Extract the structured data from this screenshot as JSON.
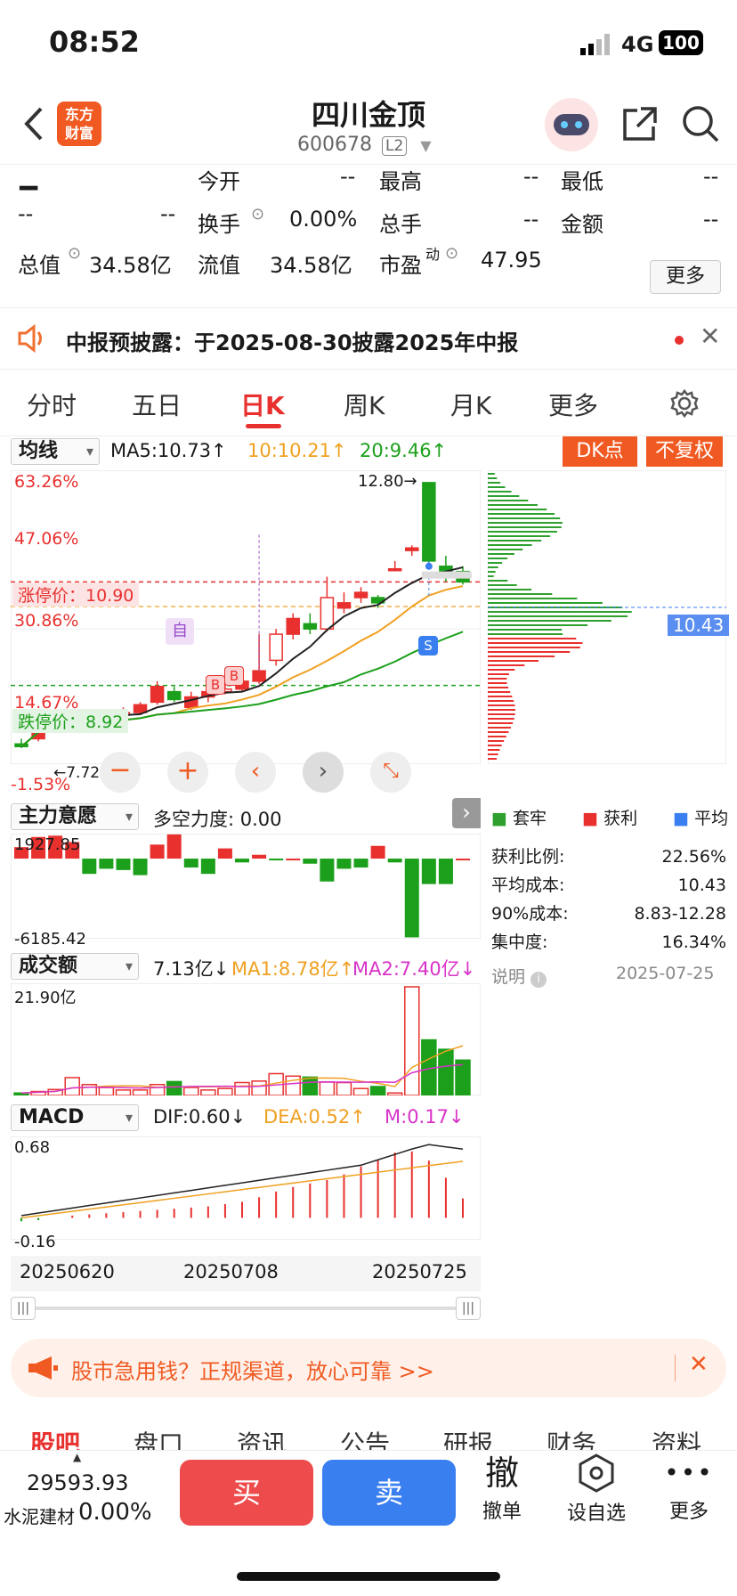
{
  "status": {
    "time": "08:52",
    "network": "4G",
    "battery": "100"
  },
  "header": {
    "title": "四川金顶",
    "code": "600678",
    "level": "L2",
    "logo_line1": "东方",
    "logo_line2": "财富"
  },
  "quote": {
    "price": "--",
    "change": "--",
    "change_pct": "--",
    "open_label": "今开",
    "open": "--",
    "high_label": "最高",
    "high": "--",
    "low_label": "最低",
    "low": "--",
    "turnover_label": "换手",
    "turnover": "0.00%",
    "volume_label": "总手",
    "volume": "--",
    "amount_label": "金额",
    "amount": "--",
    "mktcap_label": "总值",
    "mktcap": "34.58亿",
    "float_label": "流值",
    "float": "34.58亿",
    "pe_label": "市盈",
    "pe_sup": "动",
    "pe": "47.95",
    "more": "更多"
  },
  "notice": {
    "text": "中报预披露：于2025-08-30披露2025年中报"
  },
  "tabs": [
    "分时",
    "五日",
    "日K",
    "周K",
    "月K",
    "更多"
  ],
  "active_tab": "日K",
  "kline": {
    "indicator": "均线",
    "ma5": "MA5:10.73↑",
    "ma10": "10:10.21↑",
    "ma20": "20:9.46↑",
    "dk": "DK点",
    "adjust": "不复权",
    "pct_labels": [
      "63.26%",
      "47.06%",
      "30.86%",
      "14.67%",
      "-1.53%"
    ],
    "limit_up_label": "涨停价：10.90",
    "limit_down_label": "跌停价：8.92",
    "max_label": "12.80→",
    "min_label": "←7.72",
    "marker_self": "自",
    "marker_b1": "B",
    "marker_b2": "B",
    "marker_s": "S",
    "avg_cost_tag": "10.43"
  },
  "mainforce": {
    "label": "主力意愿",
    "force": "多空力度: 0.00",
    "max": "1927.85",
    "min": "-6185.42"
  },
  "chip": {
    "legend": [
      {
        "name": "套牢",
        "color": "#2ea02e"
      },
      {
        "name": "获利",
        "color": "#e8312f"
      },
      {
        "name": "平均",
        "color": "#3a7ff0"
      }
    ],
    "rows": [
      {
        "k": "获利比例:",
        "v": "22.56%"
      },
      {
        "k": "平均成本:",
        "v": "10.43"
      },
      {
        "k": "90%成本:",
        "v": "8.83-12.28"
      },
      {
        "k": "集中度:",
        "v": "16.34%"
      }
    ],
    "note": "说明",
    "date": "2025-07-25"
  },
  "volume": {
    "label": "成交额",
    "cur": "7.13亿↓",
    "ma1": "MA1:8.78亿↑",
    "ma2": "MA2:7.40亿↓",
    "max": "21.90亿"
  },
  "macd": {
    "label": "MACD",
    "dif": "DIF:0.60↓",
    "dea": "DEA:0.52↑",
    "m": "M:0.17↓",
    "max": "0.68",
    "min": "-0.16"
  },
  "dates": [
    "20250620",
    "20250708",
    "20250725"
  ],
  "ad": {
    "text": "股市急用钱？正规渠道，放心可靠 >>"
  },
  "subtabs": [
    "股吧",
    "盘口",
    "资讯",
    "公告",
    "研报",
    "财务",
    "资料"
  ],
  "bottom": {
    "index": "29593.93",
    "sector": "水泥建材",
    "sector_pct": "0.00%",
    "buy": "买",
    "sell": "卖",
    "cancel_icon": "撤",
    "cancel": "撤单",
    "watch": "设自选",
    "more": "更多"
  },
  "chart_data": {
    "type": "candlestick",
    "dates_shown": [
      "20250620",
      "20250708",
      "20250725"
    ],
    "candles": [
      {
        "o": 7.8,
        "c": 7.75,
        "h": 7.9,
        "l": 7.72
      },
      {
        "o": 7.9,
        "c": 8.3,
        "h": 8.35,
        "l": 7.85
      },
      {
        "o": 8.4,
        "c": 8.45,
        "h": 8.5,
        "l": 8.3
      },
      {
        "o": 8.2,
        "c": 8.25,
        "h": 8.3,
        "l": 8.15
      },
      {
        "o": 8.3,
        "c": 8.3,
        "h": 8.35,
        "l": 8.2
      },
      {
        "o": 8.3,
        "c": 8.35,
        "h": 8.4,
        "l": 8.25
      },
      {
        "o": 8.35,
        "c": 8.4,
        "h": 8.5,
        "l": 8.3
      },
      {
        "o": 8.4,
        "c": 8.55,
        "h": 8.6,
        "l": 8.35
      },
      {
        "o": 8.6,
        "c": 8.9,
        "h": 9.0,
        "l": 8.55
      },
      {
        "o": 8.8,
        "c": 8.65,
        "h": 8.9,
        "l": 8.6
      },
      {
        "o": 8.5,
        "c": 8.7,
        "h": 8.8,
        "l": 8.45
      },
      {
        "o": 8.7,
        "c": 8.8,
        "h": 8.9,
        "l": 8.6
      },
      {
        "o": 8.8,
        "c": 8.85,
        "h": 8.95,
        "l": 8.75
      },
      {
        "o": 8.85,
        "c": 9.0,
        "h": 9.1,
        "l": 8.8
      },
      {
        "o": 9.0,
        "c": 9.2,
        "h": 9.9,
        "l": 8.95
      },
      {
        "o": 9.4,
        "c": 9.9,
        "h": 10.0,
        "l": 9.3
      },
      {
        "o": 9.9,
        "c": 10.2,
        "h": 10.3,
        "l": 9.8
      },
      {
        "o": 10.1,
        "c": 10.0,
        "h": 10.3,
        "l": 9.9
      },
      {
        "o": 10.0,
        "c": 10.6,
        "h": 11.0,
        "l": 9.95
      },
      {
        "o": 10.4,
        "c": 10.5,
        "h": 10.7,
        "l": 10.3
      },
      {
        "o": 10.6,
        "c": 10.7,
        "h": 10.8,
        "l": 10.5
      },
      {
        "o": 10.6,
        "c": 10.5,
        "h": 10.65,
        "l": 10.4
      },
      {
        "o": 11.15,
        "c": 11.15,
        "h": 11.3,
        "l": 11.15
      },
      {
        "o": 11.5,
        "c": 11.55,
        "h": 11.6,
        "l": 11.4
      },
      {
        "o": 12.8,
        "c": 11.3,
        "h": 12.8,
        "l": 11.2
      },
      {
        "o": 11.2,
        "c": 11.0,
        "h": 11.4,
        "l": 10.9
      },
      {
        "o": 11.1,
        "c": 10.9,
        "h": 11.2,
        "l": 10.85
      }
    ],
    "mainforce_values": [
      900,
      1700,
      1800,
      1300,
      -1200,
      -800,
      -900,
      -1300,
      1100,
      1900,
      -700,
      -1200,
      800,
      -300,
      300,
      -100,
      0,
      -400,
      -1800,
      -800,
      -700,
      1000,
      -300,
      -6185,
      -2000,
      -2000,
      0
    ],
    "amount_yi": [
      0.5,
      0.8,
      1.2,
      3.6,
      2.2,
      1.6,
      1.1,
      1.1,
      2.2,
      2.8,
      1.6,
      1.1,
      1.4,
      2.6,
      2.9,
      4.4,
      3.9,
      3.7,
      2.7,
      2.6,
      1.4,
      1.8,
      0.5,
      21.9,
      11.2,
      9.3,
      7.13
    ],
    "macd_hist": [
      -0.03,
      -0.02,
      0.0,
      0.02,
      0.03,
      0.04,
      0.05,
      0.06,
      0.07,
      0.08,
      0.09,
      0.1,
      0.12,
      0.14,
      0.18,
      0.23,
      0.27,
      0.3,
      0.33,
      0.38,
      0.45,
      0.5,
      0.57,
      0.58,
      0.5,
      0.35,
      0.17
    ],
    "dif_range": [
      -0.16,
      0.68
    ]
  }
}
